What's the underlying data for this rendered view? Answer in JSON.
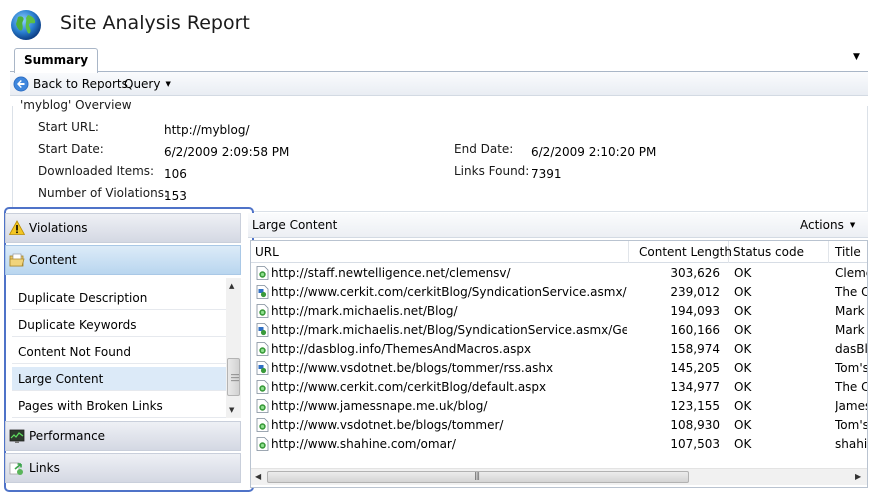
{
  "app": {
    "title": "Site Analysis Report"
  },
  "tabs": [
    {
      "label": "Summary",
      "selected": true
    }
  ],
  "toolbar": {
    "back_label": "Back to Reports",
    "query_label": "Query"
  },
  "overview": {
    "title": "'myblog' Overview",
    "start_url_label": "Start URL:",
    "start_url": "http://myblog/",
    "start_date_label": "Start Date:",
    "start_date": "6/2/2009 2:09:58 PM",
    "end_date_label": "End Date:",
    "end_date": "6/2/2009 2:10:20 PM",
    "downloaded_label": "Downloaded Items:",
    "downloaded": "106",
    "links_label": "Links Found:",
    "links": "7391",
    "violations_label": "Number of Violations:",
    "violations": "153"
  },
  "nav": {
    "categories": {
      "violations": "Violations",
      "content": "Content",
      "performance": "Performance",
      "links": "Links"
    },
    "content_items": [
      "Duplicate Description",
      "Duplicate Keywords",
      "Content Not Found",
      "Large Content",
      "Pages with Broken Links"
    ],
    "selected_item": "Large Content"
  },
  "content": {
    "title": "Large Content",
    "actions_label": "Actions",
    "columns": [
      "URL",
      "Content Length",
      "Status code",
      "Title"
    ],
    "rows": [
      {
        "icon": "page-icon",
        "url": "http://staff.newtelligence.net/clemensv/",
        "length": "303,626",
        "status": "OK",
        "title": "Cleme"
      },
      {
        "icon": "feed-page-icon",
        "url": "http://www.cerkit.com/cerkitBlog/SyndicationService.asmx/GetRss",
        "length": "239,012",
        "status": "OK",
        "title": "The Ce"
      },
      {
        "icon": "page-icon",
        "url": "http://mark.michaelis.net/Blog/",
        "length": "194,093",
        "status": "OK",
        "title": "Mark M"
      },
      {
        "icon": "feed-page-icon",
        "url": "http://mark.michaelis.net/Blog/SyndicationService.asmx/GetRss",
        "length": "160,166",
        "status": "OK",
        "title": "Mark M"
      },
      {
        "icon": "page-icon",
        "url": "http://dasblog.info/ThemesAndMacros.aspx",
        "length": "158,974",
        "status": "OK",
        "title": "dasBlo"
      },
      {
        "icon": "feed-page-icon",
        "url": "http://www.vsdotnet.be/blogs/tommer/rss.ashx",
        "length": "145,205",
        "status": "OK",
        "title": "Tom's"
      },
      {
        "icon": "page-icon",
        "url": "http://www.cerkit.com/cerkitBlog/default.aspx",
        "length": "134,977",
        "status": "OK",
        "title": "The Ce"
      },
      {
        "icon": "page-icon",
        "url": "http://www.jamessnape.me.uk/blog/",
        "length": "123,155",
        "status": "OK",
        "title": "James"
      },
      {
        "icon": "page-icon",
        "url": "http://www.vsdotnet.be/blogs/tommer/",
        "length": "108,930",
        "status": "OK",
        "title": "Tom's"
      },
      {
        "icon": "page-icon",
        "url": "http://www.shahine.com/omar/",
        "length": "107,503",
        "status": "OK",
        "title": "shahir"
      }
    ]
  },
  "colors": {
    "nav_border": "#4f73c8",
    "selection": "#dceaf8",
    "grid_border": "#b9c3d0"
  }
}
